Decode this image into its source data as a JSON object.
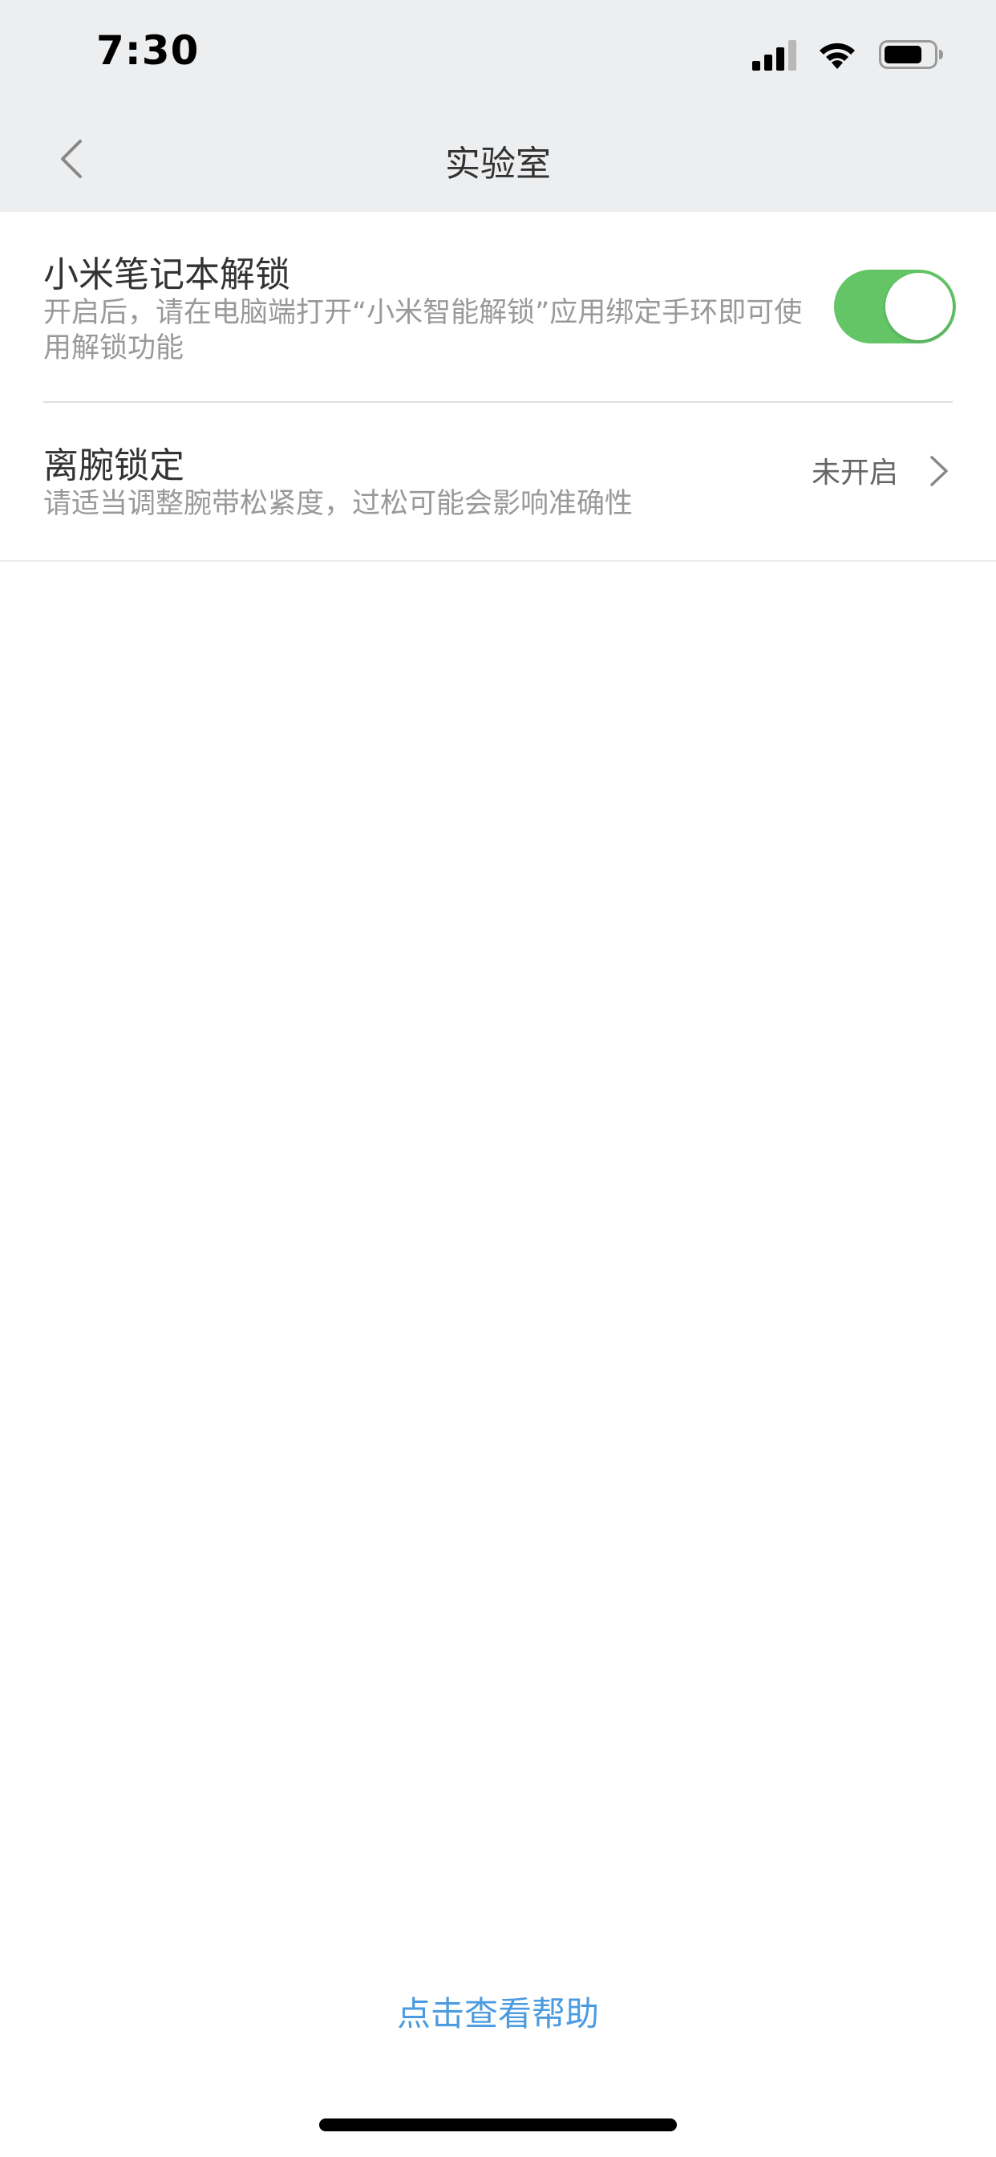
{
  "status_bar": {
    "time": "7:30",
    "icons": [
      "cellular-signal-icon",
      "wifi-icon",
      "battery-icon"
    ]
  },
  "nav": {
    "title": "实验室",
    "back_icon": "chevron-left-icon"
  },
  "settings": {
    "unlock": {
      "title": "小米笔记本解锁",
      "description": "开启后，请在电脑端打开“小米智能解锁”应用绑定手环即可使用解锁功能",
      "enabled": true
    },
    "wrist_lock": {
      "title": "离腕锁定",
      "description": "请适当调整腕带松紧度，过松可能会影响准确性",
      "value": "未开启",
      "icon": "chevron-right-icon"
    }
  },
  "footer": {
    "help_link": "点击查看帮助"
  },
  "colors": {
    "toggle_on": "#63c566",
    "link": "#4c9be0",
    "header_bg": "#edeef0"
  }
}
